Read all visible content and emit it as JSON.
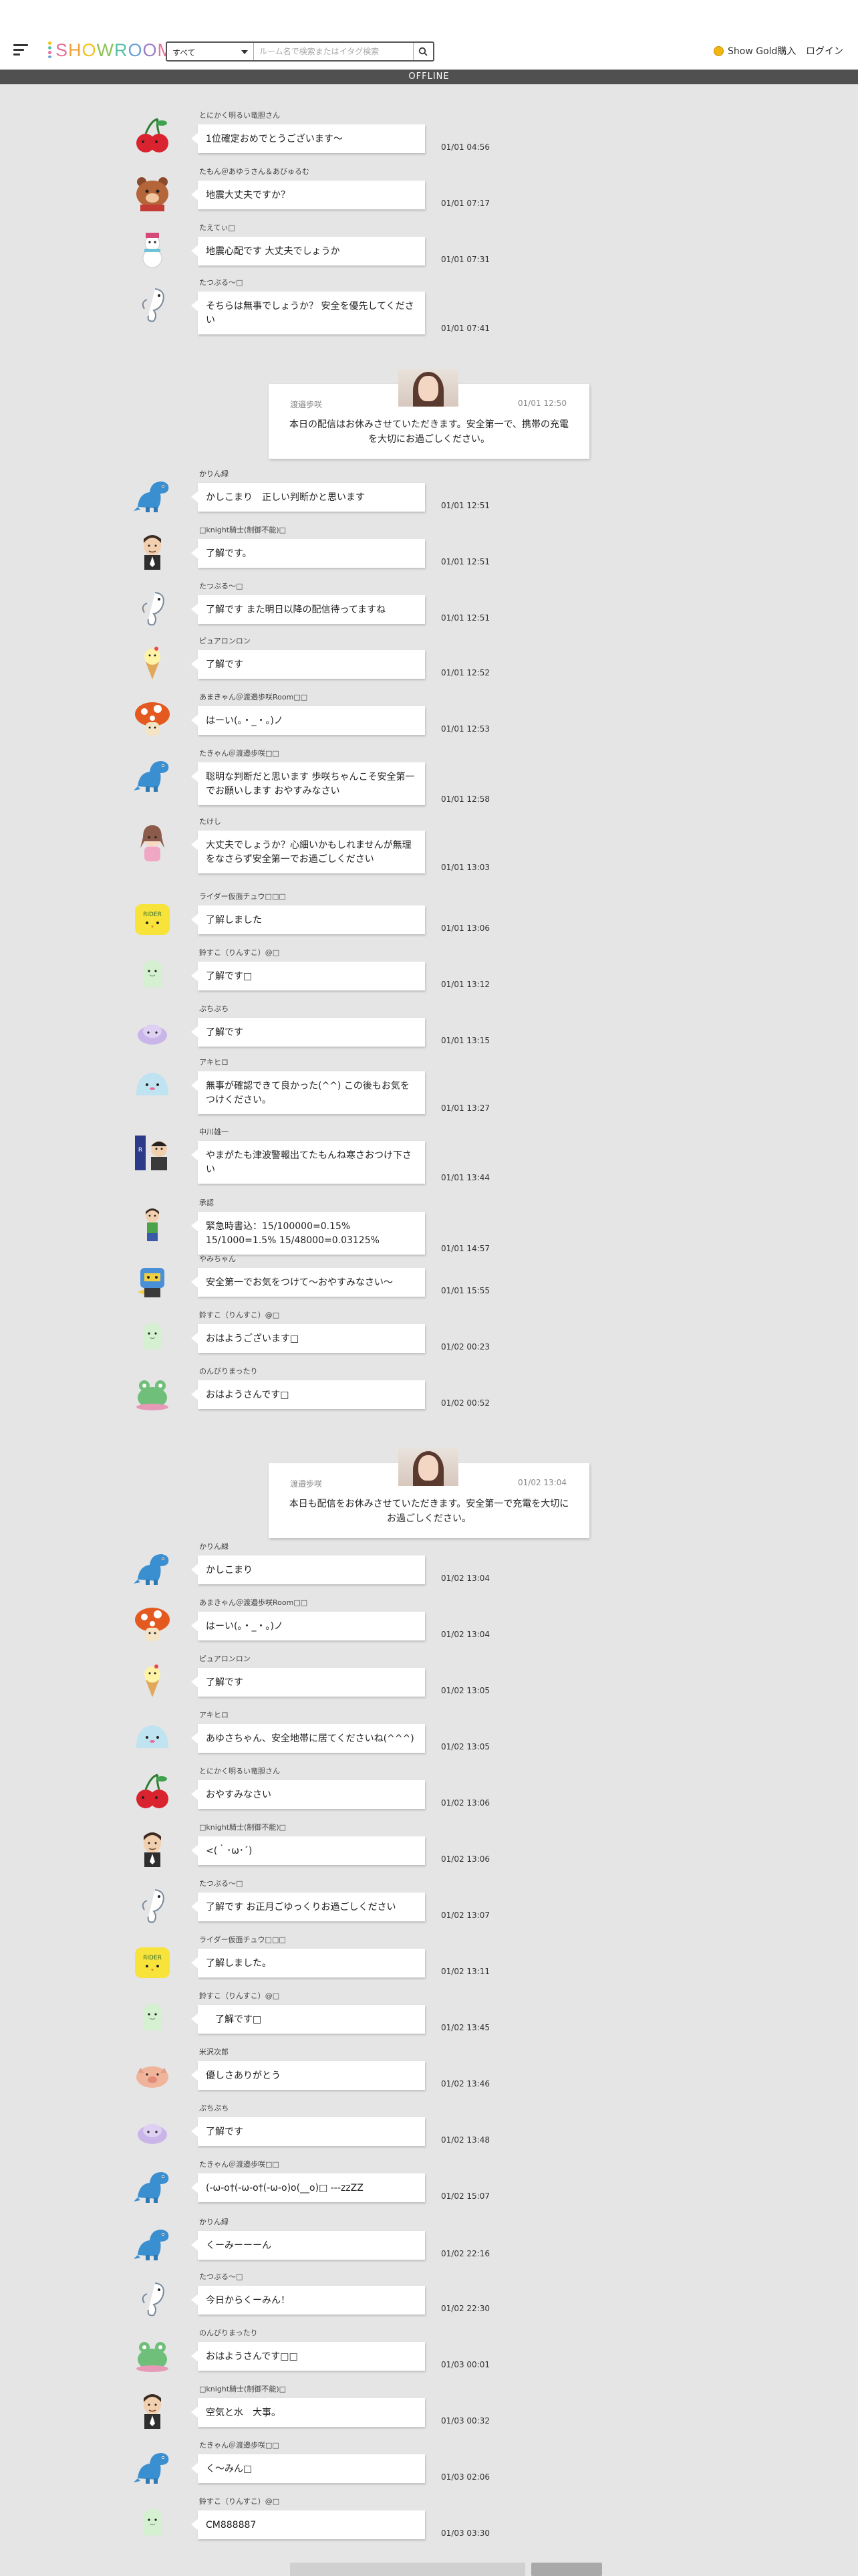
{
  "header": {
    "logo_text": "SHOWROOM",
    "search_select": "すべて",
    "search_placeholder": "ルーム名で検索またはイタグ検索",
    "gold_label": "Show Gold購入",
    "login_label": "ログイン"
  },
  "status": {
    "offline_label": "OFFLINE"
  },
  "colors": {
    "offline_bar": "#505050",
    "gold_coin": "#f1b60f"
  },
  "icons": {
    "menu": "menu-icon",
    "search": "search-icon",
    "coin": "gold-coin-icon"
  },
  "telops": [
    {
      "name": "渡邉歩咲",
      "time": "01/01 12:50",
      "text": "本日の配信はお休みさせていただきます。安全第一で、携帯の充電を大切にお過ごしください。"
    },
    {
      "name": "渡邉歩咲",
      "time": "01/02 13:04",
      "text": "本日も配信をお休みさせていただきます。安全第一で充電を大切にお過ごしください。"
    }
  ],
  "comments": [
    {
      "name": "とにかく明るい竜胆さん",
      "text": "1位確定おめでとうございます〜",
      "time": "01/01 04:56",
      "avatar": "cherry"
    },
    {
      "name": "たもん＠あゆうさん＆あびゅるむ",
      "text": "地震大丈夫ですか？",
      "time": "01/01 07:17",
      "avatar": "bear"
    },
    {
      "name": "たえてぃ□",
      "text": "地震心配です 大丈夫でしょうか",
      "time": "01/01 07:31",
      "avatar": "snowman"
    },
    {
      "name": "たつぶる〜□",
      "text": "そちらは無事でしょうか？ 安全を優先してください",
      "time": "01/01 07:41",
      "avatar": "seahorse"
    },
    {
      "name": "かりん緑",
      "text": "かしこまり　正しい判断かと思います",
      "time": "01/01 12:51",
      "avatar": "dino"
    },
    {
      "name": "□knight騎士(制御不能)□",
      "text": "了解です。",
      "time": "01/01 12:51",
      "avatar": "man"
    },
    {
      "name": "たつぶる〜□",
      "text": "了解です また明日以降の配信待ってますね",
      "time": "01/01 12:51",
      "avatar": "seahorse"
    },
    {
      "name": "ピュアロンロン",
      "text": "了解です",
      "time": "01/01 12:52",
      "avatar": "icecream"
    },
    {
      "name": "あまきゃん＠渡邉歩咲Room□□",
      "text": "はーい(。・_・。)ノ",
      "time": "01/01 12:53",
      "avatar": "mushroom"
    },
    {
      "name": "たきゃん＠渡邉歩咲□□",
      "text": "聡明な判断だと思います 歩咲ちゃんこそ安全第一でお願いします おやすみなさい",
      "time": "01/01 12:58",
      "avatar": "dino"
    },
    {
      "name": "たけし",
      "text": "大丈夫でしょうか？心細いかもしれませんが無理をなさらず安全第一でお過ごしください",
      "time": "01/01 13:03",
      "avatar": "girl"
    },
    {
      "name": "ライダー仮面チュウ□□□",
      "text": "了解しました",
      "time": "01/01 13:06",
      "avatar": "chick"
    },
    {
      "name": "鈴すこ（りんすこ）@□",
      "text": "了解です□",
      "time": "01/01 13:12",
      "avatar": "ghost"
    },
    {
      "name": "ぷちぷち",
      "text": "了解です",
      "time": "01/01 13:15",
      "avatar": "blob"
    },
    {
      "name": "アキヒロ",
      "text": "無事が確認できて良かった(^^) この後もお気をつけください。",
      "time": "01/01 13:27",
      "avatar": "slime"
    },
    {
      "name": "中川雄一",
      "text": "やまがたも津波警報出てたもんね寒さおつけ下さい",
      "time": "01/01 13:44",
      "avatar": "panel"
    },
    {
      "name": "承認",
      "text": "緊急時書込：15/100000=0.15% 15/1000=1.5% 15/48000=0.03125%",
      "time": "01/01 14:57",
      "avatar": "boy"
    },
    {
      "name": "やみちゃん",
      "text": "安全第一でお気をつけて〜おやすみなさい〜",
      "time": "01/01 15:55",
      "avatar": "robot"
    },
    {
      "name": "鈴すこ（りんすこ）@□",
      "text": "おはようございます□",
      "time": "01/02 00:23",
      "avatar": "ghost"
    },
    {
      "name": "のんびりまったり",
      "text": "おはようさんです□",
      "time": "01/02 00:52",
      "avatar": "frog"
    },
    {
      "name": "かりん緑",
      "text": "かしこまり",
      "time": "01/02 13:04",
      "avatar": "dino"
    },
    {
      "name": "あまきゃん＠渡邉歩咲Room□□",
      "text": "はーい(。・_・。)ノ",
      "time": "01/02 13:04",
      "avatar": "mushroom"
    },
    {
      "name": "ピュアロンロン",
      "text": "了解です",
      "time": "01/02 13:05",
      "avatar": "icecream"
    },
    {
      "name": "アキヒロ",
      "text": "あゆさちゃん、安全地帯に居てくださいね(^^^)",
      "time": "01/02 13:05",
      "avatar": "slime"
    },
    {
      "name": "とにかく明るい竜胆さん",
      "text": "おやすみなさい",
      "time": "01/02 13:06",
      "avatar": "cherry"
    },
    {
      "name": "□knight騎士(制御不能)□",
      "text": "<(｀･ω･´)",
      "time": "01/02 13:06",
      "avatar": "man"
    },
    {
      "name": "たつぶる〜□",
      "text": "了解です お正月ごゆっくりお過ごしください",
      "time": "01/02 13:07",
      "avatar": "seahorse"
    },
    {
      "name": "ライダー仮面チュウ□□□",
      "text": "了解しました。",
      "time": "01/02 13:11",
      "avatar": "chick"
    },
    {
      "name": "鈴すこ（りんすこ）@□",
      "text": "　了解です□",
      "time": "01/02 13:45",
      "avatar": "ghost"
    },
    {
      "name": "米沢次郎",
      "text": "優しさありがとう",
      "time": "01/02 13:46",
      "avatar": "pig"
    },
    {
      "name": "ぷちぷち",
      "text": "了解です",
      "time": "01/02 13:48",
      "avatar": "blob"
    },
    {
      "name": "たきゃん＠渡邉歩咲□□",
      "text": "(-ω-o†(-ω-o†(-ω-o)o(__o)□ ---zzZZ",
      "time": "01/02 15:07",
      "avatar": "dino"
    },
    {
      "name": "かりん緑",
      "text": "くーみーーーん",
      "time": "01/02 22:16",
      "avatar": "dino"
    },
    {
      "name": "たつぶる〜□",
      "text": "今日からくーみん！",
      "time": "01/02 22:30",
      "avatar": "seahorse"
    },
    {
      "name": "のんびりまったり",
      "text": "おはようさんです□□",
      "time": "01/03 00:01",
      "avatar": "frog"
    },
    {
      "name": "□knight騎士(制御不能)□",
      "text": "空気と水　大事。",
      "time": "01/03 00:32",
      "avatar": "man"
    },
    {
      "name": "たきゃん＠渡邉歩咲□□",
      "text": "く〜みん□",
      "time": "01/03 02:06",
      "avatar": "dino"
    },
    {
      "name": "鈴すこ（りんすこ）@□",
      "text": "CM888887",
      "time": "01/03 03:30",
      "avatar": "ghost"
    }
  ]
}
